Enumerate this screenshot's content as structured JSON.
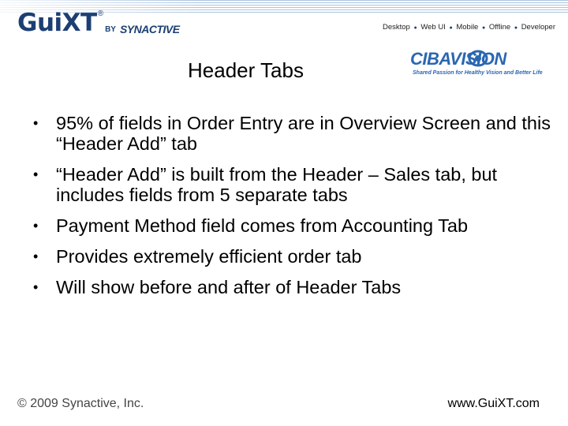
{
  "header": {
    "brand_main": "GuiXT",
    "brand_registered": "®",
    "brand_by": "BY",
    "brand_company": "SYNACTIVE",
    "nav": [
      "Desktop",
      "Web UI",
      "Mobile",
      "Offline",
      "Developer"
    ],
    "nav_separator": "●"
  },
  "partner_logo": {
    "name": "CIBAVISION",
    "tagline": "Shared Passion for Healthy Vision and Better Life",
    "color": "#2a67b1"
  },
  "slide": {
    "title": "Header Tabs",
    "bullet_symbol": "•",
    "bullets": [
      "95% of fields in Order Entry are in Overview Screen and this “Header Add” tab",
      "“Header Add” is built from the Header – Sales tab, but includes fields from 5 separate tabs",
      "Payment Method field comes from Accounting Tab",
      "Provides extremely efficient order tab",
      "Will show before and after of Header Tabs"
    ]
  },
  "footer": {
    "copyright": "© 2009 Synactive, Inc.",
    "website": "www.GuiXT.com"
  },
  "colors": {
    "brand_navy": "#1c3f73",
    "stripe_blue": "#8fb0d6"
  }
}
